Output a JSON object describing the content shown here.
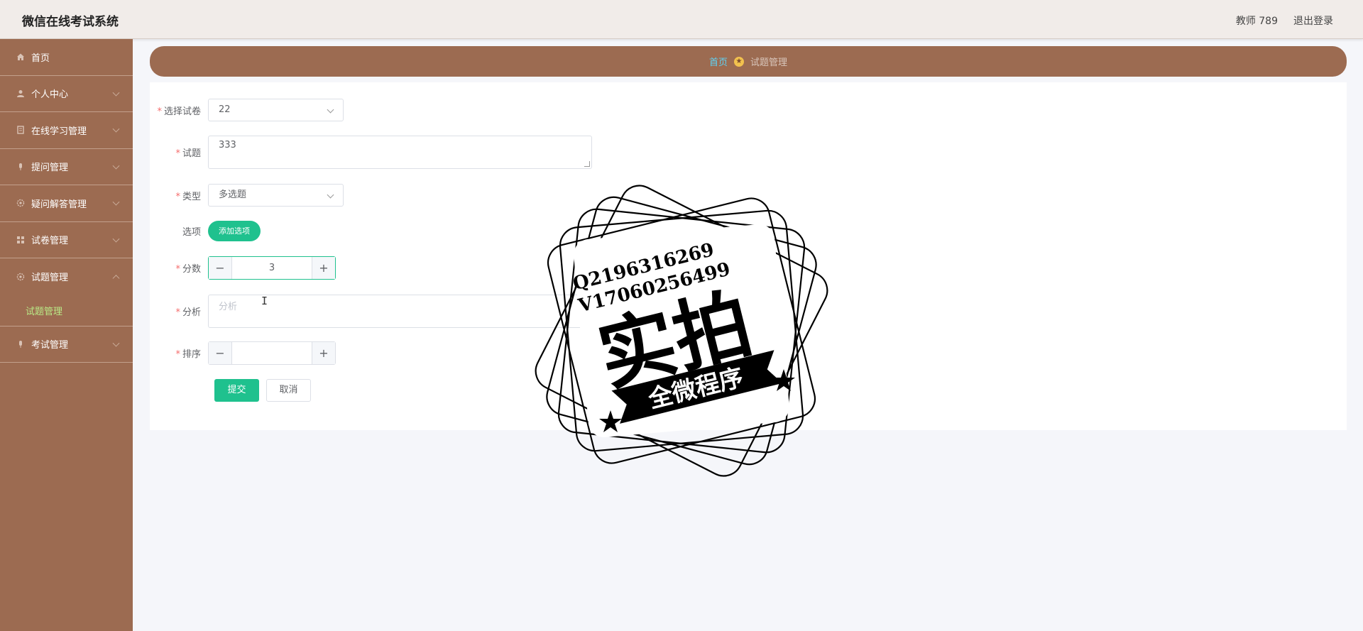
{
  "header": {
    "app_title": "微信在线考试系统",
    "user_name": "教师 789",
    "logout": "退出登录"
  },
  "sidebar": {
    "items": [
      {
        "label": "首页",
        "icon": "home-icon"
      },
      {
        "label": "个人中心",
        "icon": "user-icon"
      },
      {
        "label": "在线学习管理",
        "icon": "book-icon"
      },
      {
        "label": "提问管理",
        "icon": "mic-icon"
      },
      {
        "label": "疑问解答管理",
        "icon": "settings-icon"
      },
      {
        "label": "试卷管理",
        "icon": "grid-icon"
      },
      {
        "label": "试题管理",
        "icon": "settings-icon"
      },
      {
        "label": "考试管理",
        "icon": "mic-icon"
      }
    ],
    "submenu_active": "试题管理"
  },
  "breadcrumb": {
    "home": "首页",
    "current": "试题管理"
  },
  "form": {
    "paper": {
      "label": "选择试卷",
      "value": "22"
    },
    "question": {
      "label": "试题",
      "value": "333"
    },
    "type": {
      "label": "类型",
      "value": "多选题"
    },
    "options": {
      "label": "选项",
      "button": "添加选项"
    },
    "score": {
      "label": "分数",
      "value": "3",
      "minus": "−",
      "plus": "+"
    },
    "analysis": {
      "label": "分析",
      "placeholder": "分析"
    },
    "order": {
      "label": "排序",
      "value": "",
      "minus": "−",
      "plus": "+"
    },
    "submit": "提交",
    "cancel": "取消"
  },
  "watermark": {
    "line1": "Q2196316269",
    "line2": "V17060256499",
    "main": "实拍",
    "banner": "全微程序"
  },
  "colors": {
    "sidebar": "#9c6b51",
    "accent": "#1fc18e",
    "active_submenu": "#b9e986",
    "breadcrumb_home": "#5fd3f5"
  }
}
